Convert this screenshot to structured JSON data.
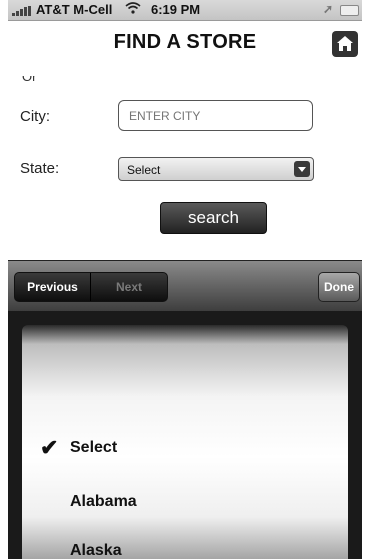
{
  "status_bar": {
    "carrier": "AT&T M-Cell",
    "time": "6:19 PM"
  },
  "header": {
    "title": "FIND A STORE"
  },
  "form": {
    "cutoff_label": "Or",
    "city_label": "City:",
    "city_placeholder": "ENTER CITY",
    "state_label": "State:",
    "state_value": "Select",
    "search_label": "search"
  },
  "toolbar": {
    "previous_label": "Previous",
    "next_label": "Next",
    "done_label": "Done"
  },
  "picker": {
    "options": [
      {
        "label": "Select",
        "selected": true
      },
      {
        "label": "Alabama",
        "selected": false
      },
      {
        "label": "Alaska",
        "selected": false
      }
    ]
  },
  "icons": {
    "signal": "signal-bars-icon",
    "wifi": "wifi-icon",
    "location": "location-arrow-icon",
    "battery": "battery-icon",
    "home": "home-icon",
    "dropdown": "chevron-down-icon",
    "check": "checkmark-icon"
  },
  "colors": {
    "toolbar": "#3e3e3e",
    "button_dark": "#222222",
    "picker_bg": "#1a1a1a"
  }
}
